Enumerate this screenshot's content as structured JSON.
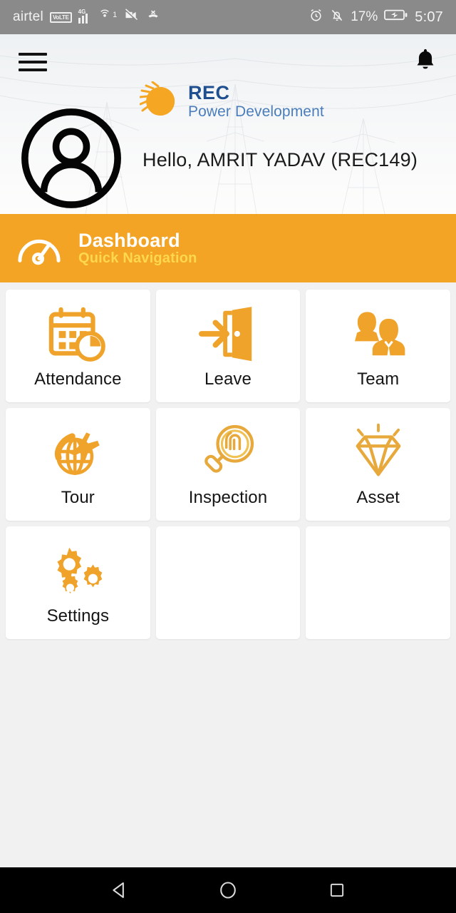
{
  "status_bar": {
    "carrier": "airtel",
    "volte_badge": "VoLTE",
    "network_type": "4G",
    "signal_icon": "signal-bars-icon",
    "hotspot_icon": "hotspot-icon",
    "hotspot_superscript": "1",
    "camera_muted_icon": "camera-off-icon",
    "missed_call_icon": "call-missed-icon",
    "alarm_icon": "alarm-clock-icon",
    "silent_icon": "bell-muted-icon",
    "battery_percent": "17%",
    "battery_icon": "battery-charging-icon",
    "time": "5:07"
  },
  "header": {
    "menu_icon": "hamburger-menu-icon",
    "notification_icon": "bell-icon",
    "logo": {
      "mark_icon": "rec-sun-logo-icon",
      "name": "REC",
      "tagline": "Power Development"
    },
    "avatar_icon": "user-avatar-icon",
    "greeting": "Hello, AMRIT YADAV (REC149)"
  },
  "dashboard_banner": {
    "icon": "speedometer-icon",
    "title": "Dashboard",
    "subtitle": "Quick Navigation"
  },
  "grid": {
    "tiles": [
      {
        "label": "Attendance",
        "icon": "calendar-clock-icon",
        "empty": false
      },
      {
        "label": "Leave",
        "icon": "exit-door-icon",
        "empty": false
      },
      {
        "label": "Team",
        "icon": "two-people-icon",
        "empty": false
      },
      {
        "label": "Tour",
        "icon": "globe-airplane-icon",
        "empty": false
      },
      {
        "label": "Inspection",
        "icon": "magnifier-fingerprint-icon",
        "empty": false
      },
      {
        "label": "Asset",
        "icon": "diamond-icon",
        "empty": false
      },
      {
        "label": "Settings",
        "icon": "gears-icon",
        "empty": false
      },
      {
        "label": "",
        "icon": "",
        "empty": true
      },
      {
        "label": "",
        "icon": "",
        "empty": true
      }
    ]
  },
  "nav_bar": {
    "back_icon": "back-triangle-icon",
    "home_icon": "home-circle-icon",
    "recents_icon": "recents-square-icon"
  },
  "colors": {
    "accent_orange": "#f4a425",
    "banner_subtitle_yellow": "#ffd84d",
    "brand_blue": "#1f4f8f",
    "brand_blue_light": "#4a7ebb",
    "status_bar_gray": "#8a8a8a",
    "page_background": "#f1f1f1",
    "tile_background": "#ffffff",
    "nav_bar_black": "#000000"
  }
}
